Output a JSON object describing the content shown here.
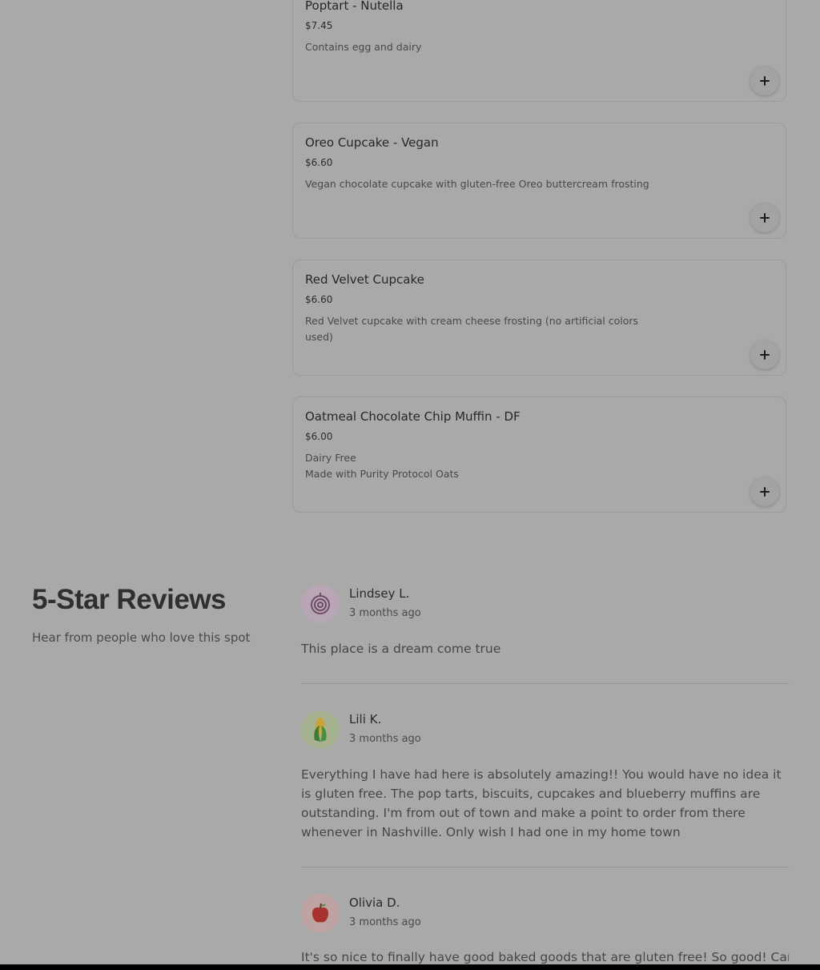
{
  "menu_items": [
    {
      "name": "Poptart - Nutella",
      "price": "$7.45",
      "description": "Contains egg and dairy",
      "add_label": "+"
    },
    {
      "name": "Oreo Cupcake - Vegan",
      "price": "$6.60",
      "description": "Vegan chocolate cupcake with gluten-free Oreo buttercream frosting",
      "add_label": "+"
    },
    {
      "name": "Red Velvet Cupcake",
      "price": "$6.60",
      "description": "Red Velvet cupcake with cream cheese frosting (no artificial colors used)",
      "add_label": "+"
    },
    {
      "name": "Oatmeal Chocolate Chip Muffin - DF",
      "price": "$6.00",
      "description": "Dairy Free\nMade with Purity Protocol Oats",
      "add_label": "+"
    }
  ],
  "reviews_section": {
    "title": "5-Star Reviews",
    "subtitle": "Hear from people who love this spot"
  },
  "reviews": [
    {
      "name": "Lindsey L.",
      "time": "3 months ago",
      "text": "This place is a dream come true",
      "avatar_icon": "onion-icon",
      "avatar_color": "#b9a6b4"
    },
    {
      "name": "Lili K.",
      "time": "3 months ago",
      "text": "Everything I have had here is absolutely amazing!! You would have no idea it is gluten free. The pop tarts, biscuits, cupcakes and blueberry muffins are outstanding. I'm from out of town and make a point to order from there whenever in Nashville. Only wish I had one in my home town",
      "avatar_icon": "corn-icon",
      "avatar_color": "#a6b28f"
    },
    {
      "name": "Olivia D.",
      "time": "3 months ago",
      "text": "It's so nice to finally have good baked goods that are gluten free! So good! Can't",
      "avatar_icon": "apple-icon",
      "avatar_color": "#bfa3a3"
    }
  ]
}
